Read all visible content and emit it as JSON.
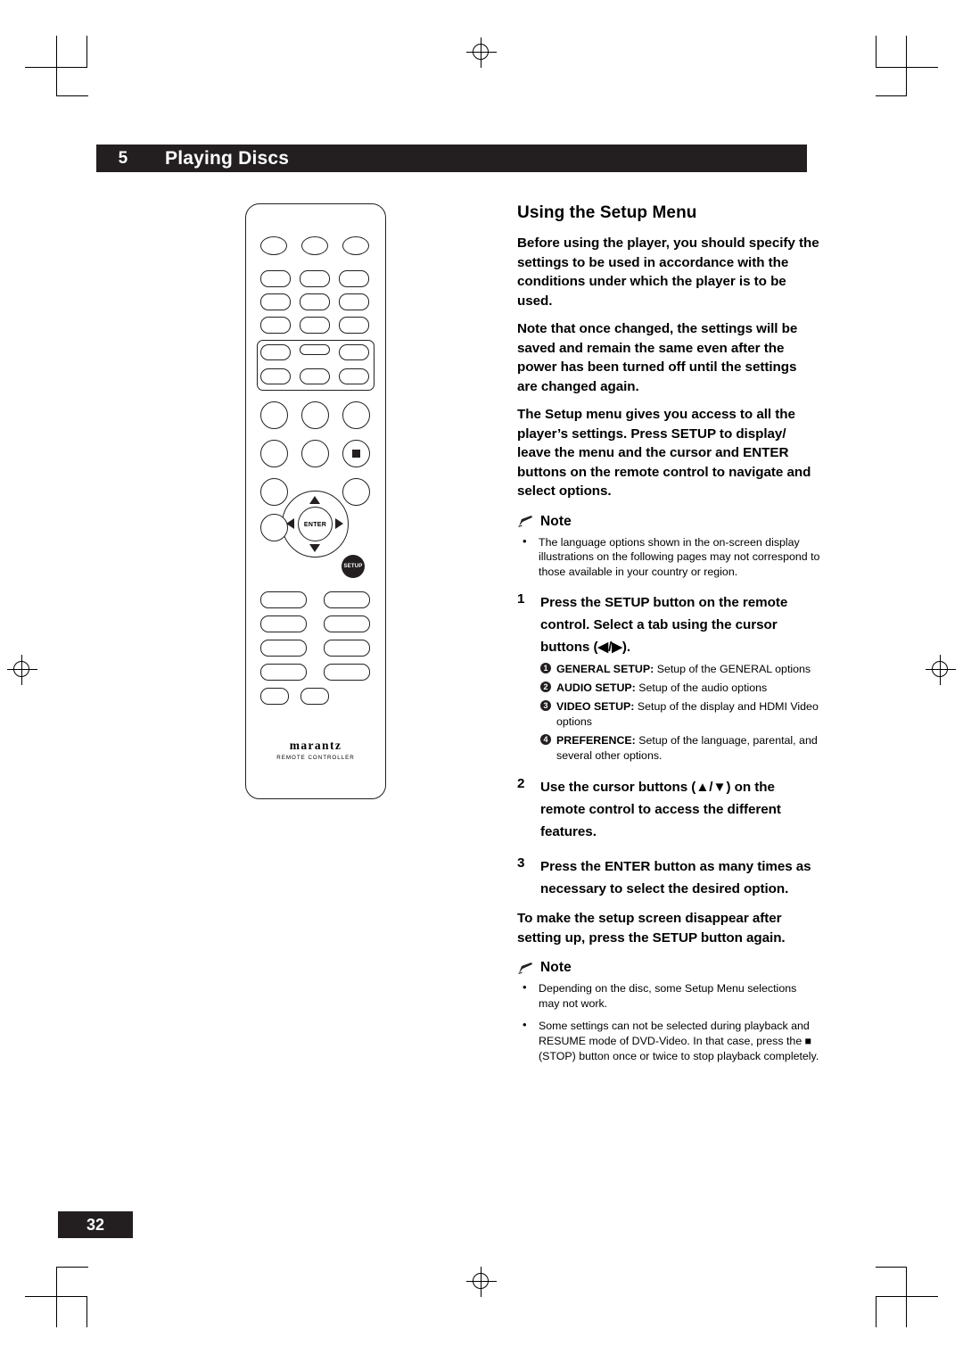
{
  "header": {
    "chapter_number": "5",
    "chapter_title": "Playing Discs"
  },
  "page_number": "32",
  "section": {
    "title": "Using the Setup Menu",
    "paragraphs": [
      "Before using the player, you should specify the settings to be used in accordance with the conditions under which the player is to be used.",
      "Note that once changed, the settings will be saved and remain the same even after the power has been turned off until the settings are changed again.",
      "The Setup menu gives you access to all the player’s settings. Press SETUP to display/ leave the menu and the cursor and ENTER buttons on the remote control to navigate and select options."
    ]
  },
  "note1": {
    "label": "Note",
    "items": [
      "The language options shown in the on-screen display illustrations on the following pages may not correspond to those available in your country or region."
    ]
  },
  "steps": [
    {
      "num": "1",
      "text": "Press the SETUP button on the remote control. Select a tab using the cursor buttons (◀/▶).",
      "sub": [
        {
          "marker": "1",
          "bold": "GENERAL SETUP:",
          "rest": " Setup of the GENERAL options"
        },
        {
          "marker": "2",
          "bold": "AUDIO SETUP:",
          "rest": " Setup of the audio options"
        },
        {
          "marker": "3",
          "bold": "VIDEO SETUP:",
          "rest": " Setup of the display and HDMI Video options"
        },
        {
          "marker": "4",
          "bold": "PREFERENCE:",
          "rest": " Setup of the language, parental, and several other options."
        }
      ]
    },
    {
      "num": "2",
      "text": "Use the cursor buttons (▲/▼) on the remote control to access the different features.",
      "sub": []
    },
    {
      "num": "3",
      "text": "Press the ENTER button as many times as necessary to select the desired option.",
      "sub": []
    }
  ],
  "closing_paragraph": "To make the setup screen disappear after setting up, press the SETUP button again.",
  "note2": {
    "label": "Note",
    "items": [
      "Depending on the disc, some Setup Menu selections may not work.",
      "Some settings can not be selected during playback and RESUME mode of DVD-Video. In that case, press the ■ (STOP) button once or twice to stop playback completely."
    ]
  },
  "remote": {
    "brand": "marantz",
    "sublabel": "REMOTE CONTROLLER",
    "enter_label": "ENTER",
    "setup_label": "SETUP"
  },
  "colors": {
    "ink": "#231f20",
    "paper": "#ffffff"
  }
}
